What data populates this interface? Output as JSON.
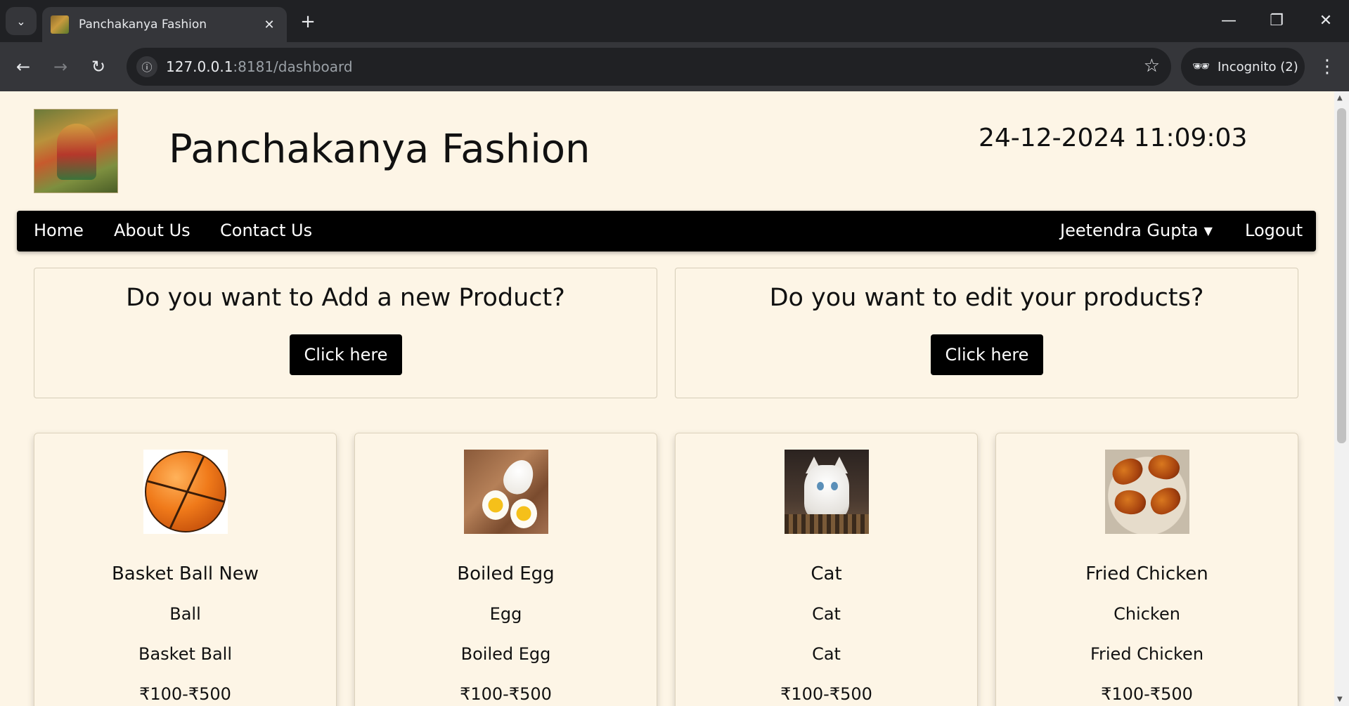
{
  "browser": {
    "tab_title": "Panchakanya Fashion",
    "tab_close": "✕",
    "new_tab": "+",
    "url_host": "127.0.0.1",
    "url_path": ":8181/dashboard",
    "incognito_label": "Incognito (2)"
  },
  "header": {
    "site_title": "Panchakanya Fashion",
    "datetime": "24-12-2024 11:09:03"
  },
  "navbar": {
    "home": "Home",
    "about": "About Us",
    "contact": "Contact Us",
    "user_name": "Jeetendra Gupta",
    "logout": "Logout"
  },
  "actions": [
    {
      "question": "Do you want to Add a new Product?",
      "button": "Click here"
    },
    {
      "question": "Do you want to edit your products?",
      "button": "Click here"
    }
  ],
  "products": [
    {
      "name": "Basket Ball New",
      "category": "Ball",
      "description": "Basket Ball",
      "price": "₹100-₹500",
      "image": "basketball-photo"
    },
    {
      "name": "Boiled Egg",
      "category": "Egg",
      "description": "Boiled Egg",
      "price": "₹100-₹500",
      "image": "boiled-egg-photo"
    },
    {
      "name": "Cat",
      "category": "Cat",
      "description": "Cat",
      "price": "₹100-₹500",
      "image": "kitten-photo"
    },
    {
      "name": "Fried Chicken",
      "category": "Chicken",
      "description": "Fried Chicken",
      "price": "₹100-₹500",
      "image": "fried-chicken-photo"
    }
  ],
  "icons": {
    "tab_list": "chevron-down-icon",
    "back": "arrow-left-icon",
    "forward": "arrow-right-icon",
    "reload": "reload-icon",
    "site_info": "info-icon",
    "bookmark": "star-icon",
    "incognito": "incognito-icon",
    "menu": "three-dots-icon",
    "minimize": "minimize-icon",
    "restore": "restore-icon",
    "close": "close-icon",
    "user_dropdown": "caret-down-icon"
  },
  "colors": {
    "page_background": "#fdf5e6",
    "navbar_background": "#000000",
    "button_background": "#000000",
    "chrome_dark": "#202124",
    "chrome_toolbar": "#35363a"
  }
}
